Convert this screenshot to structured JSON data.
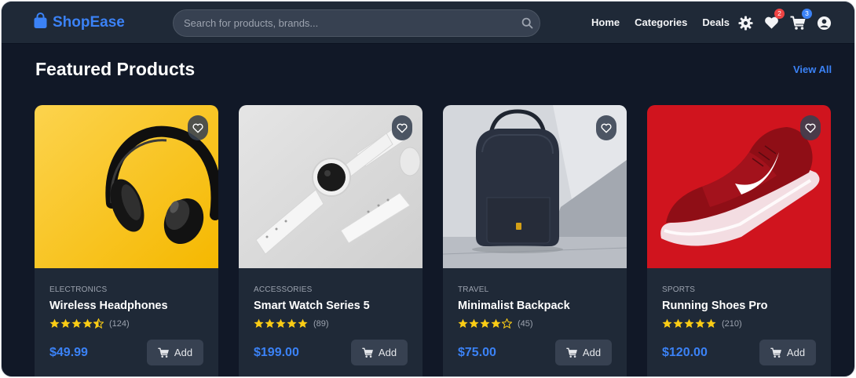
{
  "navbar": {
    "brand": "ShopEase",
    "brand_icon": "shopping-bag-icon",
    "search_placeholder": "Search for products, brands...",
    "links": [
      "Home",
      "Categories",
      "Deals"
    ],
    "icons": [
      "settings-icon",
      "heart-icon",
      "cart-icon",
      "user-icon"
    ],
    "wishlist_count": "2",
    "cart_count": "3",
    "wishlist_badge_color": "#ef4444",
    "cart_badge_color": "#3b82f6"
  },
  "section": {
    "title": "Featured Products",
    "view_all": "View All"
  },
  "colors": {
    "accent": "#3b82f6",
    "background": "#111827",
    "card": "#1f2937",
    "star": "#facc15"
  },
  "products": [
    {
      "category": "ELECTRONICS",
      "name": "Wireless Headphones",
      "rating": 4.5,
      "reviews": "(124)",
      "price": "$49.99",
      "add_label": "Add",
      "image": "headphones"
    },
    {
      "category": "ACCESSORIES",
      "name": "Smart Watch Series 5",
      "rating": 5,
      "reviews": "(89)",
      "price": "$199.00",
      "add_label": "Add",
      "image": "smart-watch"
    },
    {
      "category": "TRAVEL",
      "name": "Minimalist Backpack",
      "rating": 4,
      "reviews": "(45)",
      "price": "$75.00",
      "add_label": "Add",
      "image": "backpack"
    },
    {
      "category": "SPORTS",
      "name": "Running Shoes Pro",
      "rating": 5,
      "reviews": "(210)",
      "price": "$120.00",
      "add_label": "Add",
      "image": "running-shoe"
    }
  ]
}
